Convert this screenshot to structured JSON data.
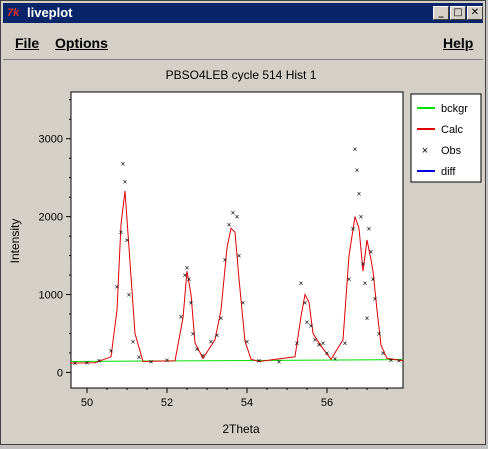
{
  "window": {
    "title": "liveplot",
    "icon": "tk-feather-icon",
    "icon_glyph": "7k",
    "controls": [
      {
        "name": "minimize",
        "glyph": "_"
      },
      {
        "name": "maximize",
        "glyph": "□"
      },
      {
        "name": "close",
        "glyph": "✕"
      }
    ]
  },
  "menubar": {
    "file": {
      "label": "File"
    },
    "options": {
      "label": "Options"
    },
    "help": {
      "label": "Help"
    }
  },
  "chart_data": {
    "type": "scatter",
    "title": "PBSO4LEB cycle 514 Hist 1",
    "xlabel": "2Theta",
    "ylabel": "Intensity",
    "xlim": [
      49.6,
      57.9
    ],
    "ylim": [
      -200,
      3600
    ],
    "xticks": [
      50,
      52,
      54,
      56
    ],
    "yticks": [
      0,
      1000,
      2000,
      3000
    ],
    "legend_position": "right",
    "series": [
      {
        "name": "bckgr",
        "color": "#00e000",
        "style": "line",
        "x": [
          49.6,
          57.9
        ],
        "y": [
          140,
          165
        ]
      },
      {
        "name": "Calc",
        "color": "#e00000",
        "style": "line",
        "x": [
          49.6,
          50.2,
          50.6,
          50.75,
          50.85,
          50.95,
          51.05,
          51.2,
          51.4,
          52.2,
          52.4,
          52.5,
          52.6,
          52.7,
          52.9,
          53.2,
          53.35,
          53.5,
          53.6,
          53.7,
          53.8,
          53.95,
          54.1,
          54.3,
          55.2,
          55.35,
          55.45,
          55.55,
          55.65,
          55.8,
          55.95,
          56.1,
          56.4,
          56.55,
          56.7,
          56.8,
          56.9,
          57.0,
          57.1,
          57.15,
          57.25,
          57.35,
          57.5,
          57.9
        ],
        "y": [
          120,
          125,
          200,
          800,
          1900,
          2330,
          1600,
          500,
          140,
          150,
          700,
          1300,
          1000,
          380,
          180,
          420,
          800,
          1600,
          1850,
          1800,
          1200,
          400,
          170,
          140,
          200,
          720,
          1000,
          900,
          500,
          380,
          270,
          170,
          420,
          1500,
          2000,
          1850,
          1300,
          1700,
          1450,
          1300,
          800,
          350,
          180,
          150
        ]
      },
      {
        "name": "Obs",
        "color": "#000000",
        "style": "marker",
        "x": [
          49.7,
          50.0,
          50.3,
          50.6,
          50.75,
          50.85,
          50.9,
          50.95,
          51.0,
          51.05,
          51.15,
          51.3,
          51.6,
          52.0,
          52.35,
          52.45,
          52.5,
          52.55,
          52.6,
          52.65,
          52.75,
          52.9,
          53.1,
          53.25,
          53.35,
          53.45,
          53.55,
          53.65,
          53.75,
          53.8,
          53.9,
          54.0,
          54.3,
          54.8,
          55.25,
          55.35,
          55.45,
          55.5,
          55.6,
          55.7,
          55.8,
          55.9,
          56.0,
          56.2,
          56.45,
          56.55,
          56.65,
          56.7,
          56.75,
          56.8,
          56.85,
          56.9,
          56.95,
          57.0,
          57.05,
          57.1,
          57.15,
          57.2,
          57.3,
          57.4,
          57.6,
          57.8
        ],
        "y": [
          120,
          130,
          150,
          280,
          1100,
          1800,
          2680,
          2450,
          1700,
          1000,
          400,
          200,
          140,
          160,
          720,
          1250,
          1350,
          1200,
          900,
          500,
          300,
          220,
          400,
          480,
          700,
          1450,
          1900,
          2050,
          2000,
          1500,
          900,
          400,
          150,
          140,
          380,
          1150,
          900,
          650,
          600,
          420,
          360,
          380,
          250,
          180,
          380,
          1200,
          1850,
          2870,
          2600,
          2300,
          2000,
          1400,
          1150,
          700,
          1850,
          1550,
          1200,
          950,
          500,
          250,
          160,
          150
        ]
      },
      {
        "name": "diff",
        "color": "#0000e0",
        "style": "line",
        "x": [],
        "y": []
      }
    ]
  }
}
